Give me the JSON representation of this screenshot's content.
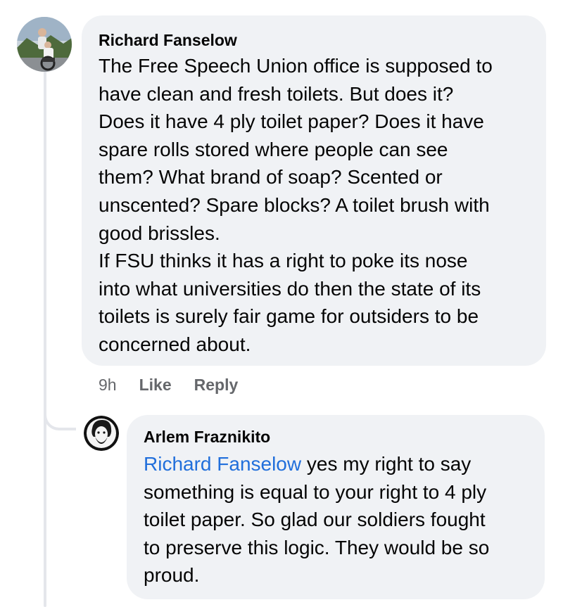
{
  "comment": {
    "author": "Richard Fanselow",
    "text": "The Free Speech Union office is supposed to\nhave clean and fresh toilets. But does it?\nDoes it have 4 ply toilet paper? Does it have\nspare rolls stored where people can see\nthem? What brand of soap? Scented or\nunscented? Spare blocks? A toilet brush with\ngood brissles.\nIf FSU thinks it has a right to poke its nose\ninto what universities do then the state of its\ntoilets is surely fair game for outsiders to be\nconcerned about.",
    "time": "9h",
    "like_label": "Like",
    "reply_label": "Reply"
  },
  "reply": {
    "author": "Arlem Fraznikito",
    "mention": "Richard Fanselow",
    "text": " yes my right to say\nsomething is equal to your right to 4 ply\ntoilet paper. So glad our soldiers fought\nto preserve this logic. They would be so\nproud."
  },
  "colors": {
    "bubble": "#f0f2f5",
    "mention": "#216fdb",
    "meta": "#65676b",
    "thread_line": "#e4e6eb"
  }
}
